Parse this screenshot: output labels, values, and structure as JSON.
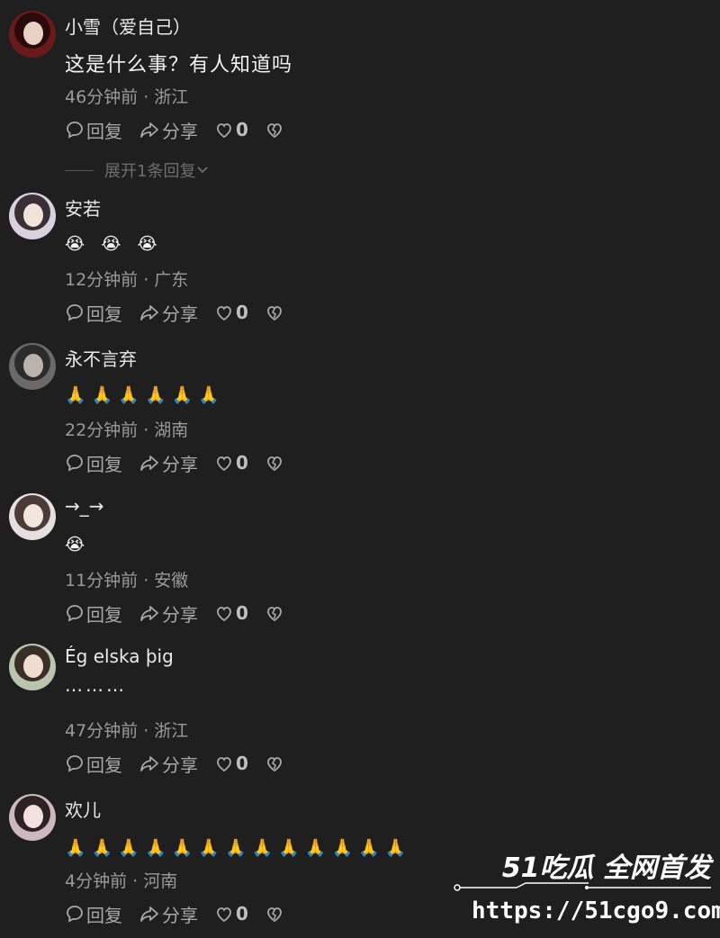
{
  "comments": [
    {
      "username": "小雪（爱自己）",
      "content": "这是什么事？有人知道吗",
      "meta": "46分钟前 · 浙江",
      "reply_label": "回复",
      "share_label": "分享",
      "likes": "0",
      "expand_label": "展开1条回复"
    },
    {
      "username": "安若",
      "content": "😭 😭 😭",
      "meta": "12分钟前 · 广东",
      "reply_label": "回复",
      "share_label": "分享",
      "likes": "0"
    },
    {
      "username": "永不言弃",
      "content": "🙏🙏🙏🙏🙏🙏",
      "meta": "22分钟前 · 湖南",
      "reply_label": "回复",
      "share_label": "分享",
      "likes": "0"
    },
    {
      "username": "→_→",
      "content": "😭",
      "meta": "11分钟前 · 安徽",
      "reply_label": "回复",
      "share_label": "分享",
      "likes": "0"
    },
    {
      "username": "Ég elska þig",
      "content": "………",
      "meta": "47分钟前 · 浙江",
      "reply_label": "回复",
      "share_label": "分享",
      "likes": "0"
    },
    {
      "username": "欢儿",
      "content": "🙏🙏🙏🙏🙏🙏🙏🙏🙏🙏🙏🙏🙏",
      "meta": "4分钟前 · 河南",
      "reply_label": "回复",
      "share_label": "分享",
      "likes": "0"
    }
  ],
  "icons": {
    "reply": "comment-bubble-icon",
    "share": "share-arrow-icon",
    "like": "heart-icon",
    "dislike": "broken-heart-icon",
    "expand": "chevron-down-icon"
  },
  "watermark": {
    "brand": "51吃瓜 全网首发",
    "url": "https://51cgo9.com"
  },
  "colors": {
    "background": "#1f1f1f",
    "text": "#e9e9e9",
    "muted": "#9a9a9a"
  }
}
